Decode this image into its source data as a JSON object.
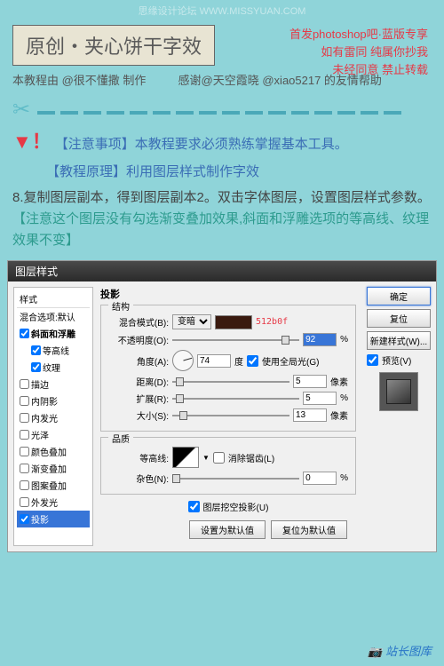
{
  "watermark": "思缘设计论坛 WWW.MISSYUAN.COM",
  "red1": "首发photoshop吧·蓝版专享",
  "red2": "如有雷同 纯属你抄我",
  "red3": "未经同意 禁止转载",
  "title": "原创・夹心饼干字效",
  "subtitle": "本教程由 @很不懂撒 制作",
  "thanks": "感谢@天空霞晓 @xiao5217 的友情帮助",
  "notice1": "【注意事项】本教程要求必须熟练掌握基本工具。",
  "notice2": "【教程原理】利用图层样式制作字效",
  "step": "8.复制图层副本，得到图层副本2。双击字体图层，设置图层样式参数。",
  "step_note": "【注意这个图层没有勾选渐变叠加效果,斜面和浮雕选项的等高线、纹理效果不变】",
  "dlg_title": "图层样式",
  "side_header": "样式",
  "side_items": [
    "混合选项:默认",
    "斜面和浮雕",
    "等高线",
    "纹理",
    "描边",
    "内阴影",
    "内发光",
    "光泽",
    "颜色叠加",
    "渐变叠加",
    "图案叠加",
    "外发光",
    "投影"
  ],
  "side_checked": [
    false,
    true,
    true,
    true,
    false,
    false,
    false,
    false,
    false,
    false,
    false,
    false,
    true
  ],
  "main_title": "投影",
  "grp1": "结构",
  "blend_label": "混合模式(B):",
  "blend_val": "变暗",
  "opacity_label": "不透明度(O):",
  "opacity_val": "92",
  "pct": "%",
  "angle_label": "角度(A):",
  "angle_val": "74",
  "deg": "度",
  "global": "使用全局光(G)",
  "distance_label": "距离(D):",
  "distance_val": "5",
  "px": "像素",
  "spread_label": "扩展(R):",
  "spread_val": "5",
  "size_label": "大小(S):",
  "size_val": "13",
  "grp2": "品质",
  "contour_label": "等高线:",
  "antialias": "消除锯齿(L)",
  "noise_label": "杂色(N):",
  "noise_val": "0",
  "knockout": "图层挖空投影(U)",
  "btn_default": "设置为默认值",
  "btn_reset": "复位为默认值",
  "ok": "确定",
  "cancel": "复位",
  "new_style": "新建样式(W)...",
  "preview": "预览(V)",
  "hex": "512b0f",
  "site": "站长图库"
}
